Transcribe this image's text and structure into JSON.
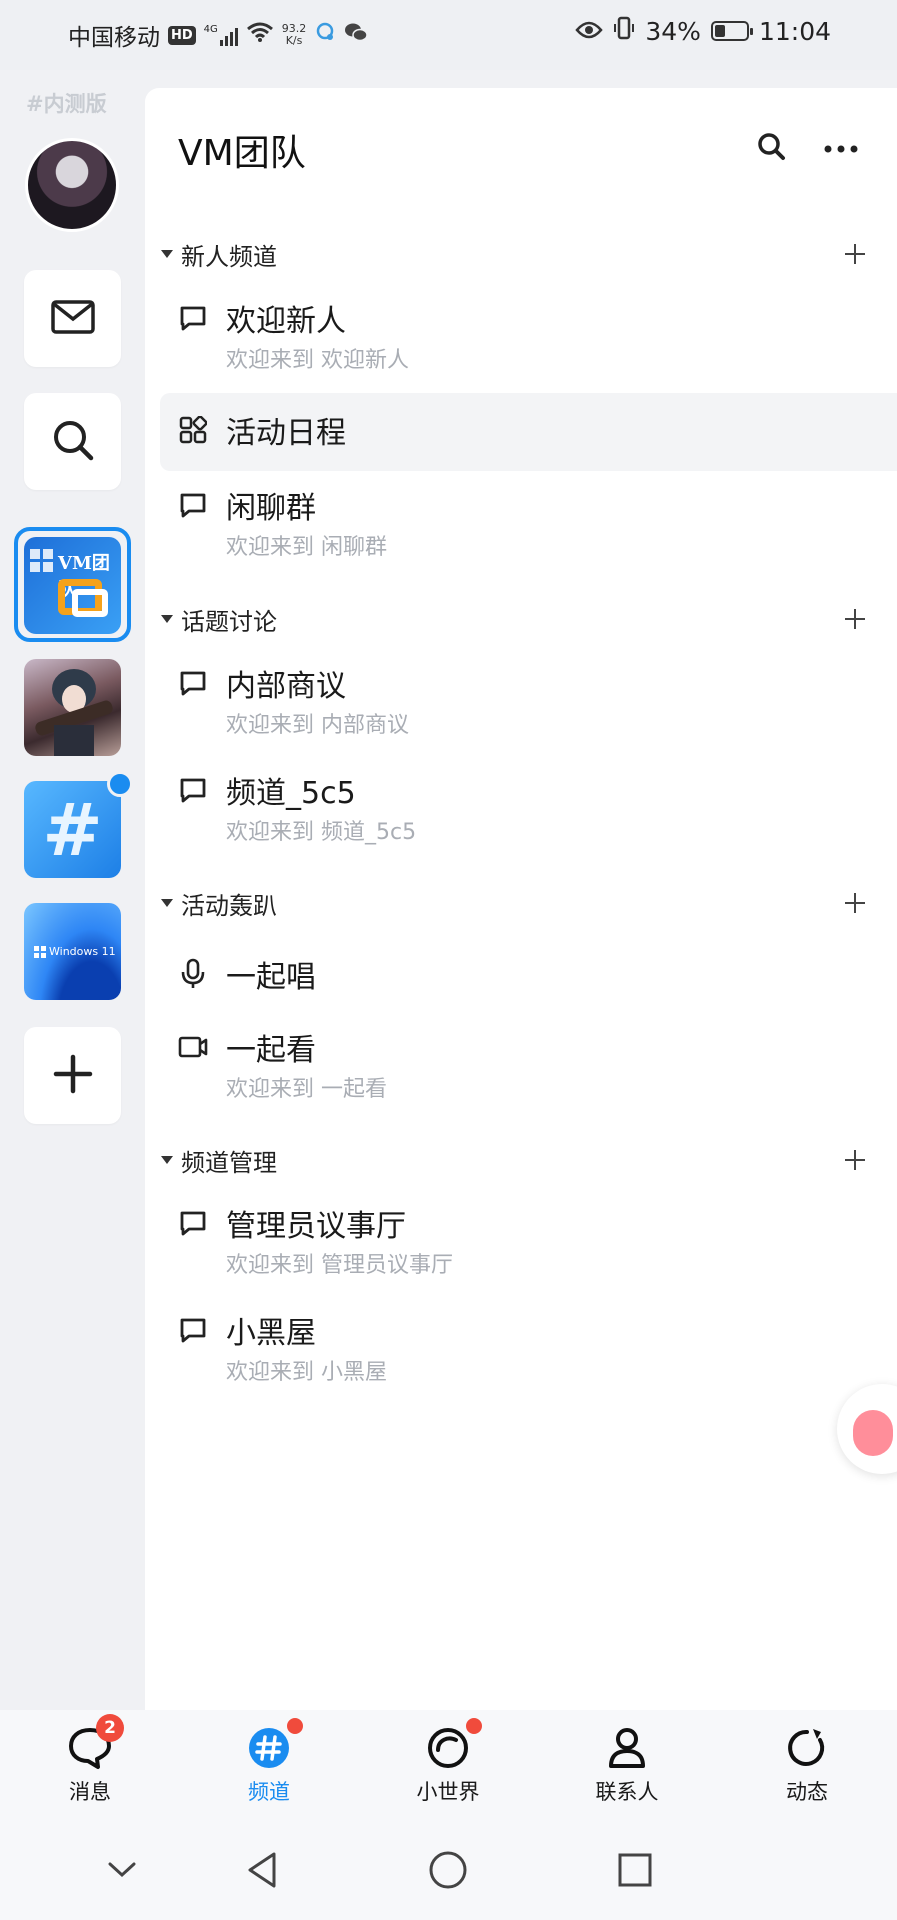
{
  "status_bar": {
    "carrier": "中国移动",
    "hd": "HD",
    "network_type": "4G",
    "speed_value": "93.2",
    "speed_unit": "K/s",
    "battery": "34%",
    "battery_level": 0.34,
    "time": "11:04"
  },
  "rail": {
    "beta_label": "#内测版",
    "guilds": [
      {
        "name": "VM团队",
        "logo_text": "VM团队"
      },
      {
        "name": "anime-guild"
      },
      {
        "name": "hash-guild",
        "has_badge": true
      },
      {
        "name": "windows11-guild",
        "logo_text": "Windows 11"
      }
    ],
    "add_label": "+"
  },
  "header": {
    "title": "VM团队"
  },
  "categories": [
    {
      "label": "新人频道",
      "channels": [
        {
          "name": "欢迎新人",
          "desc": "欢迎来到 欢迎新人",
          "icon": "chat-icon"
        },
        {
          "name": "活动日程",
          "desc": "",
          "icon": "apps-icon",
          "active": true
        },
        {
          "name": "闲聊群",
          "desc": "欢迎来到 闲聊群",
          "icon": "chat-icon"
        }
      ]
    },
    {
      "label": "话题讨论",
      "channels": [
        {
          "name": "内部商议",
          "desc": "欢迎来到 内部商议",
          "icon": "chat-icon"
        },
        {
          "name": "频道_5c5",
          "desc": "欢迎来到 频道_5c5",
          "icon": "chat-icon"
        }
      ]
    },
    {
      "label": "活动轰趴",
      "channels": [
        {
          "name": "一起唱",
          "desc": "",
          "icon": "mic-icon"
        },
        {
          "name": "一起看",
          "desc": "欢迎来到 一起看",
          "icon": "video-icon"
        }
      ]
    },
    {
      "label": "频道管理",
      "channels": [
        {
          "name": "管理员议事厅",
          "desc": "欢迎来到 管理员议事厅",
          "icon": "chat-icon"
        },
        {
          "name": "小黑屋",
          "desc": "欢迎来到 小黑屋",
          "icon": "chat-icon"
        }
      ]
    }
  ],
  "bottom_nav": [
    {
      "label": "消息",
      "badge": "2"
    },
    {
      "label": "频道",
      "active": true,
      "dot": true
    },
    {
      "label": "小世界",
      "dot": true
    },
    {
      "label": "联系人"
    },
    {
      "label": "动态"
    }
  ],
  "colors": {
    "accent": "#1a8cf0",
    "badge": "#f04b3c",
    "muted_text": "#a9adb4"
  }
}
